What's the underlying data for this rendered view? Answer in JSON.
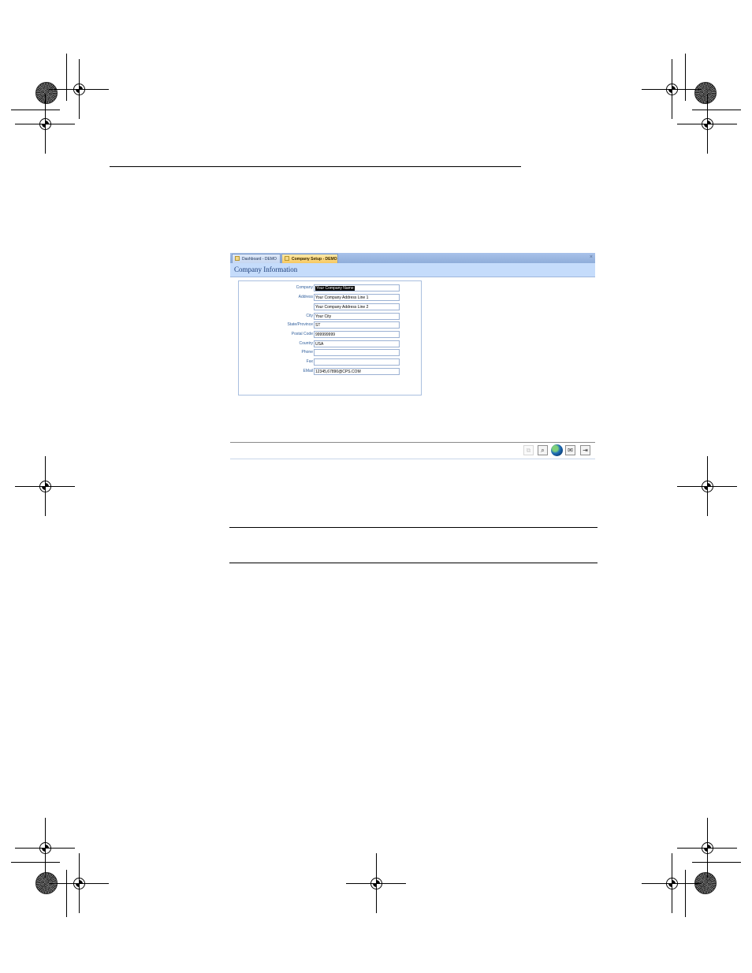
{
  "window": {
    "tabs": [
      {
        "label": "Dashboard - DEMO",
        "active": false
      },
      {
        "label": "Company Setup - DEMO",
        "active": true
      }
    ],
    "close_glyph": "×",
    "title": "Company Information"
  },
  "form": {
    "fields": [
      {
        "label": "Company",
        "value": "Your Company Name",
        "selected": true
      },
      {
        "label": "Address",
        "value": "Your Company Address Line 1"
      },
      {
        "label": "",
        "value": "Your Company Address Line 2"
      },
      {
        "label": "City",
        "value": "Your City"
      },
      {
        "label": "State/Province",
        "value": "ST"
      },
      {
        "label": "Postal Code",
        "value": "999999999"
      },
      {
        "label": "Country",
        "value": "USA"
      },
      {
        "label": "Phone",
        "value": ""
      },
      {
        "label": "Fax",
        "value": ""
      },
      {
        "label": "EMail",
        "value": "12345,67890@CPS.COM"
      }
    ]
  },
  "toolbar": {
    "buttons": [
      {
        "icon": "copy-icon",
        "glyph": "⧉",
        "disabled": true
      },
      {
        "icon": "search-icon",
        "glyph": "⌕",
        "disabled": false
      },
      {
        "icon": "globe-icon",
        "glyph": "",
        "disabled": false
      },
      {
        "icon": "mail-icon",
        "glyph": "✉",
        "disabled": false
      },
      {
        "icon": "exit-icon",
        "glyph": "⇥",
        "disabled": false
      }
    ]
  },
  "colors": {
    "tabbar": "#8fadd9",
    "header": "#c5dcfb",
    "label": "#2f5e9c",
    "title": "#1e3f7a",
    "active_tab": "#f7c860"
  }
}
